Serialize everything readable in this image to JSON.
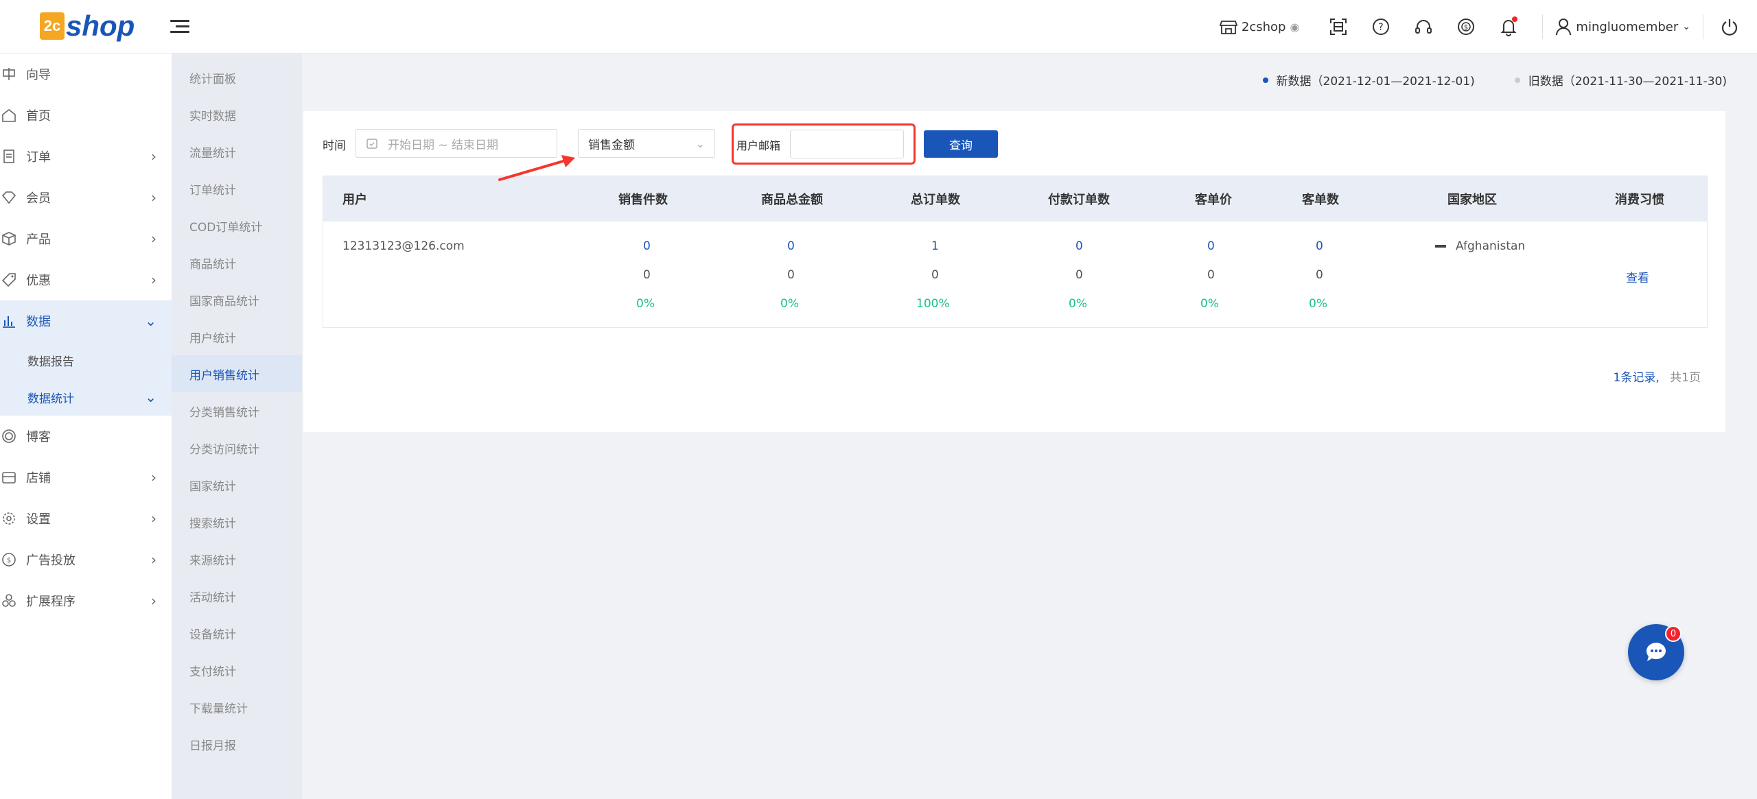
{
  "header": {
    "logo_badge": "2c",
    "logo_text": "shop",
    "shop_name": "2cshop",
    "username": "mingluomember"
  },
  "sidebar": {
    "items": [
      {
        "label": "向导",
        "icon": "guide-icon"
      },
      {
        "label": "首页",
        "icon": "home-icon"
      },
      {
        "label": "订单",
        "icon": "order-icon"
      },
      {
        "label": "会员",
        "icon": "member-icon"
      },
      {
        "label": "产品",
        "icon": "product-icon"
      },
      {
        "label": "优惠",
        "icon": "coupon-icon"
      },
      {
        "label": "数据",
        "icon": "chart-icon"
      },
      {
        "label": "博客",
        "icon": "blog-icon"
      },
      {
        "label": "店铺",
        "icon": "store-icon"
      },
      {
        "label": "设置",
        "icon": "settings-icon"
      },
      {
        "label": "广告投放",
        "icon": "ads-icon"
      },
      {
        "label": "扩展程序",
        "icon": "extension-icon"
      }
    ],
    "sub_items": [
      {
        "label": "数据报告"
      },
      {
        "label": "数据统计"
      }
    ]
  },
  "sidebar2": {
    "items": [
      {
        "label": "统计面板"
      },
      {
        "label": "实时数据"
      },
      {
        "label": "流量统计"
      },
      {
        "label": "订单统计"
      },
      {
        "label": "COD订单统计"
      },
      {
        "label": "商品统计"
      },
      {
        "label": "国家商品统计"
      },
      {
        "label": "用户统计"
      },
      {
        "label": "用户销售统计"
      },
      {
        "label": "分类销售统计"
      },
      {
        "label": "分类访问统计"
      },
      {
        "label": "国家统计"
      },
      {
        "label": "搜索统计"
      },
      {
        "label": "来源统计"
      },
      {
        "label": "活动统计"
      },
      {
        "label": "设备统计"
      },
      {
        "label": "支付统计"
      },
      {
        "label": "下载量统计"
      },
      {
        "label": "日报月报"
      }
    ]
  },
  "legend": {
    "new_label": "新数据（2021-12-01—2021-12-01)",
    "old_label": "旧数据（2021-11-30—2021-11-30)",
    "new_color": "#1a56b8",
    "old_color": "#cccccc"
  },
  "filters": {
    "time_label": "时间",
    "date_placeholder": "开始日期 ~ 结束日期",
    "metric_selected": "销售金额",
    "email_label": "用户邮箱",
    "email_value": "",
    "query_label": "查询"
  },
  "table": {
    "columns": [
      "用户",
      "销售件数",
      "商品总金额",
      "总订单数",
      "付款订单数",
      "客单价",
      "客单数",
      "国家地区",
      "消费习惯"
    ],
    "row": {
      "user": "12313123@126.com",
      "new_values": [
        "0",
        "0",
        "1",
        "0",
        "0",
        "0"
      ],
      "old_values": [
        "0",
        "0",
        "0",
        "0",
        "0",
        "0"
      ],
      "changes": [
        "0%",
        "0%",
        "100%",
        "0%",
        "0%",
        "0%"
      ],
      "country": "Afghanistan",
      "action": "查看"
    }
  },
  "pagination": {
    "records": "1条记录,",
    "pages": "共1页"
  },
  "chat": {
    "badge": "0"
  },
  "colors": {
    "accent": "#1a56b8",
    "positive": "#18c08f",
    "highlight": "#f5362e"
  }
}
